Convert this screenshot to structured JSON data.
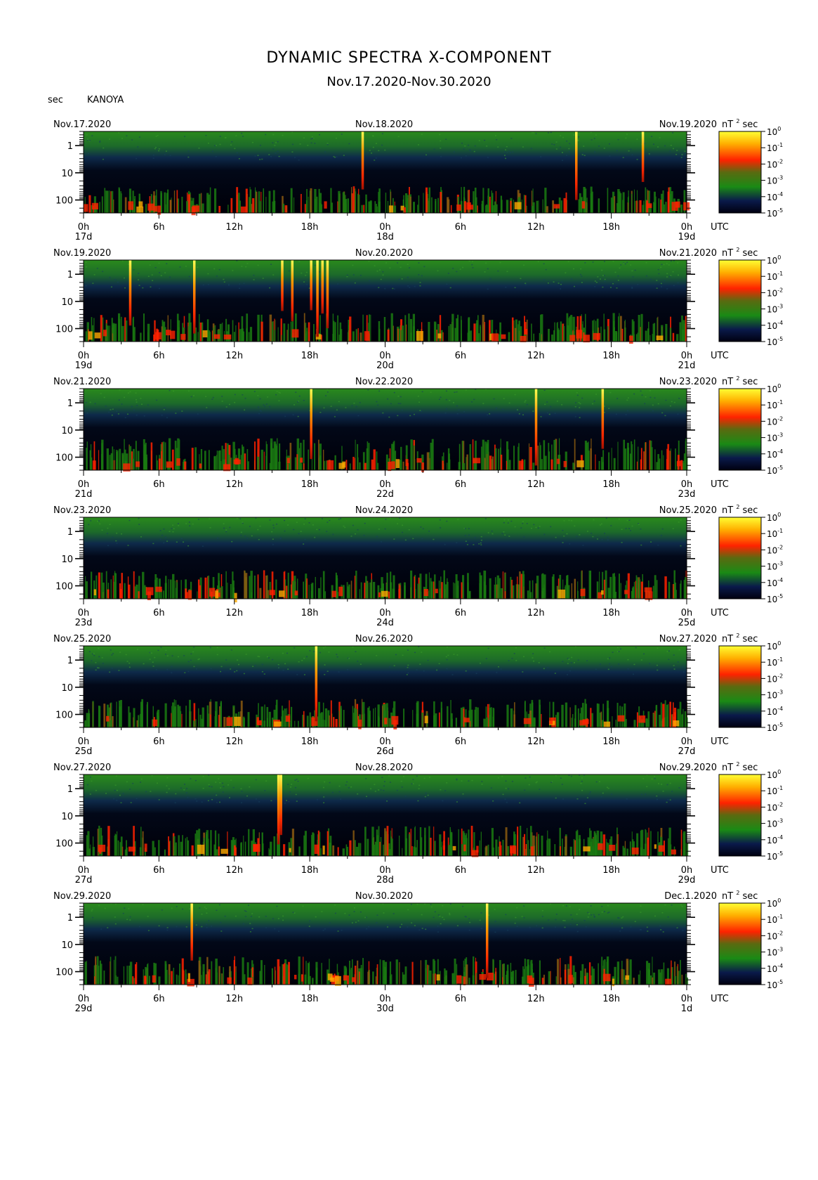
{
  "title": "DYNAMIC SPECTRA X-COMPONENT",
  "subtitle": "Nov.17.2020-Nov.30.2020",
  "y_unit": "sec",
  "station": "KANOYA",
  "colorbar_unit_base": "nT",
  "colorbar_unit_exp": "2",
  "colorbar_unit_suffix": "sec",
  "colorbar_ticks": [
    {
      "base": "10",
      "exp": "0"
    },
    {
      "base": "10",
      "exp": "-1"
    },
    {
      "base": "10",
      "exp": "-2"
    },
    {
      "base": "10",
      "exp": "-3"
    },
    {
      "base": "10",
      "exp": "-4"
    },
    {
      "base": "10",
      "exp": "-5"
    }
  ],
  "colors": {
    "high": "#ffff33",
    "mid_high": "#ff2200",
    "mid": "#1a7a12",
    "low": "#0a1a3a",
    "floor": "#000010"
  },
  "y_ticks": [
    "1",
    "10",
    "100"
  ],
  "x_ticks": [
    "0h",
    "6h",
    "12h",
    "18h",
    "0h",
    "6h",
    "12h",
    "18h",
    "0h"
  ],
  "utc_label": "UTC",
  "chart_data": {
    "type": "heatmap",
    "title": "DYNAMIC SPECTRA X-COMPONENT",
    "ylabel": "sec",
    "y_scale": "log",
    "ylim": [
      0.3,
      300
    ],
    "xlim_hours": [
      0,
      48
    ],
    "color_scale": "log",
    "color_range": [
      1e-05,
      1
    ],
    "panels": [
      {
        "left_date": "Nov.17.2020",
        "mid_date": "Nov.18.2020",
        "right_date": "Nov.19.2020",
        "day_labels": [
          "17d",
          "18d",
          "19d"
        ],
        "spikes_hours": [
          22.2,
          39.2,
          44.5
        ],
        "activity": 0.55
      },
      {
        "left_date": "Nov.19.2020",
        "mid_date": "Nov.20.2020",
        "right_date": "Nov.21.2020",
        "day_labels": [
          "19d",
          "20d",
          "21d"
        ],
        "spikes_hours": [
          3.7,
          8.8,
          15.8,
          16.6,
          18.1,
          18.6,
          19.0,
          19.4
        ],
        "activity": 0.6
      },
      {
        "left_date": "Nov.21.2020",
        "mid_date": "Nov.22.2020",
        "right_date": "Nov.23.2020",
        "day_labels": [
          "21d",
          "22d",
          "23d"
        ],
        "spikes_hours": [
          18.1,
          36.0,
          41.3
        ],
        "activity": 0.7
      },
      {
        "left_date": "Nov.23.2020",
        "mid_date": "Nov.24.2020",
        "right_date": "Nov.25.2020",
        "day_labels": [
          "23d",
          "24d",
          "25d"
        ],
        "spikes_hours": [],
        "activity": 0.6
      },
      {
        "left_date": "Nov.25.2020",
        "mid_date": "Nov.26.2020",
        "right_date": "Nov.27.2020",
        "day_labels": [
          "25d",
          "26d",
          "27d"
        ],
        "spikes_hours": [
          18.5
        ],
        "activity": 0.6
      },
      {
        "left_date": "Nov.27.2020",
        "mid_date": "Nov.28.2020",
        "right_date": "Nov.29.2020",
        "day_labels": [
          "27d",
          "28d",
          "29d"
        ],
        "spikes_hours": [
          15.5,
          15.7
        ],
        "activity": 0.65
      },
      {
        "left_date": "Nov.29.2020",
        "mid_date": "Nov.30.2020",
        "right_date": "Dec.1.2020",
        "day_labels": [
          "29d",
          "30d",
          "1d"
        ],
        "spikes_hours": [
          8.6,
          32.1
        ],
        "activity": 0.6
      }
    ]
  }
}
